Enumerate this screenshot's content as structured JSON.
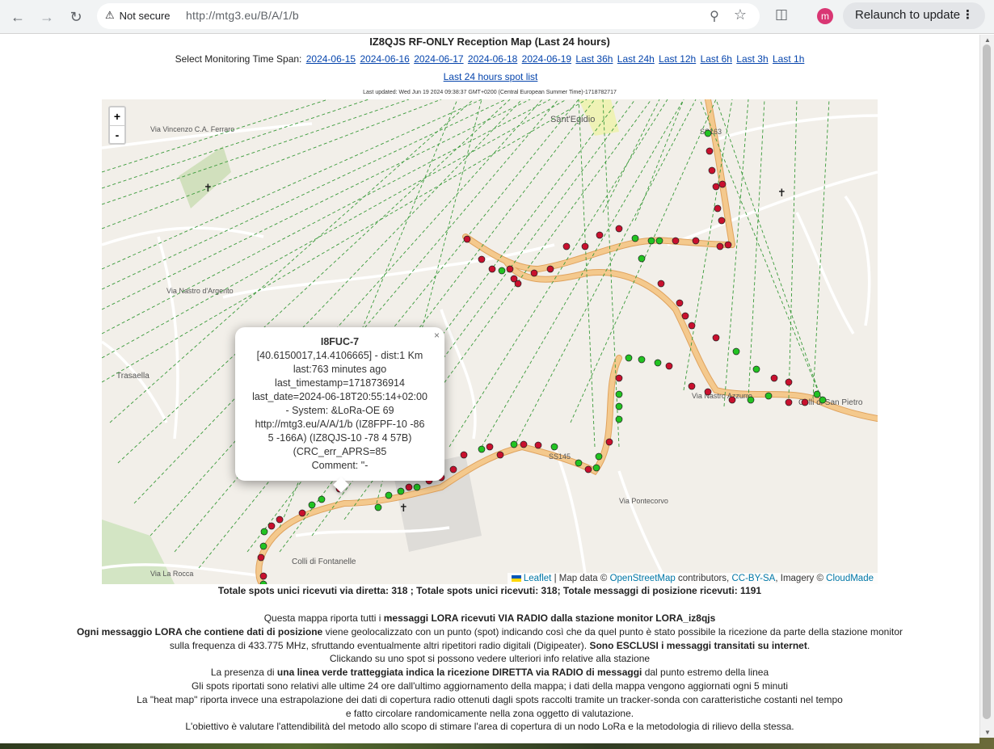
{
  "browser": {
    "security_label": "Not secure",
    "url": "http://mtg3.eu/B/A/1/b",
    "relaunch_label": "Relaunch to update",
    "profile_initial": "m"
  },
  "page": {
    "title": "IZ8QJS RF-ONLY Reception Map (Last 24 hours)",
    "timespan_label": "Select Monitoring Time Span:",
    "timespan_links": [
      "2024-06-15",
      "2024-06-16",
      "2024-06-17",
      "2024-06-18",
      "2024-06-19",
      "Last 36h",
      "Last 24h",
      "Last 12h",
      "Last 6h",
      "Last 3h",
      "Last 1h"
    ],
    "spot_list_link": "Last 24 hours spot list",
    "last_updated": "Last updated: Wed Jun 19 2024 09:38:37 GMT+0200 (Central European Summer Time)-1718782717"
  },
  "map": {
    "zoom_in": "+",
    "zoom_out": "-",
    "labels": [
      "Sant'Egidio",
      "Via Vincenzo C.A. Ferraro",
      "Via Nastro Azzurro",
      "Colli di San Pietro",
      "Colli di Fontanelle",
      "Trasaella",
      "SS145",
      "SS163",
      "Via Nastro d'Argento",
      "Via La Rocca",
      "Via Pontecorvo"
    ],
    "attribution": {
      "leaflet": "Leaflet",
      "data_text": "| Map data ©",
      "osm": "OpenStreetMap",
      "contributors": "contributors,",
      "license": "CC-BY-SA",
      "imagery": ", Imagery ©",
      "cloudmade": "CloudMade"
    },
    "popup": {
      "close": "×",
      "title": "I8FUC-7",
      "lines": [
        "[40.6150017,14.4106665] - dist:1 Km",
        "last:763 minutes ago",
        "last_timestamp=1718736914",
        "last_date=2024-06-18T20:55:14+02:00",
        "- System: &LoRa-OE 69",
        "http://mtg3.eu/A/A/1/b (IZ8FPF-10 -86",
        "5 -166A) (IZ8QJS-10 -78 4 57B)",
        "(CRC_err_APRS=85",
        "Comment: \"-"
      ]
    }
  },
  "totals": "Totale spots unici ricevuti via diretta: 318 ; Totale spots unici ricevuti: 318; Totale messaggi di posizione ricevuti: 1191",
  "description": {
    "l1_a": "Questa mappa riporta tutti i ",
    "l1_b": "messaggi LORA ricevuti VIA RADIO dalla stazione monitor LORA_iz8qjs",
    "l2_a": "Ogni messaggio LORA che contiene dati di posizione",
    "l2_b": " viene geolocalizzato con un punto (spot) indicando così che da quel punto è stato possibile la ricezione da parte della stazione monitor",
    "l3_a": "sulla frequenza di 433.775 MHz, sfruttando eventualmente altri ripetitori radio digitali (Digipeater). ",
    "l3_b": "Sono ESCLUSI i messaggi transitati su internet",
    "l3_c": ".",
    "l4": "Clickando su uno spot si possono vedere ulteriori info relative alla stazione",
    "l5_a": "La presenza di ",
    "l5_b": "una linea verde tratteggiata indica la ricezione DIRETTA via RADIO di messaggi",
    "l5_c": " dal punto estremo della linea",
    "l6": "Gli spots riportati sono relativi alle ultime 24 ore dall'ultimo aggiornamento della mappa; i dati della mappa vengono aggiornati ogni 5 minuti",
    "l7": "La \"heat map\" riporta invece una estrapolazione dei dati di copertura radio ottenuti dagli spots raccolti tramite un tracker-sonda con caratteristiche costanti nel tempo",
    "l8": "e fatto circolare randomicamente nella zona oggetto di valutazione.",
    "l9": "L'obiettivo è valutare l'attendibilità del metodo allo scopo di stimare l'area di copertura di un nodo LoRa e la metodologia di rilievo della stessa."
  },
  "colors": {
    "road_major": "#f4c98d",
    "road_outline": "#e0a35e",
    "spot_red": "#c8102e",
    "spot_green": "#22c322",
    "direct_line": "#3a9a3a",
    "map_bg": "#f2efe9"
  }
}
